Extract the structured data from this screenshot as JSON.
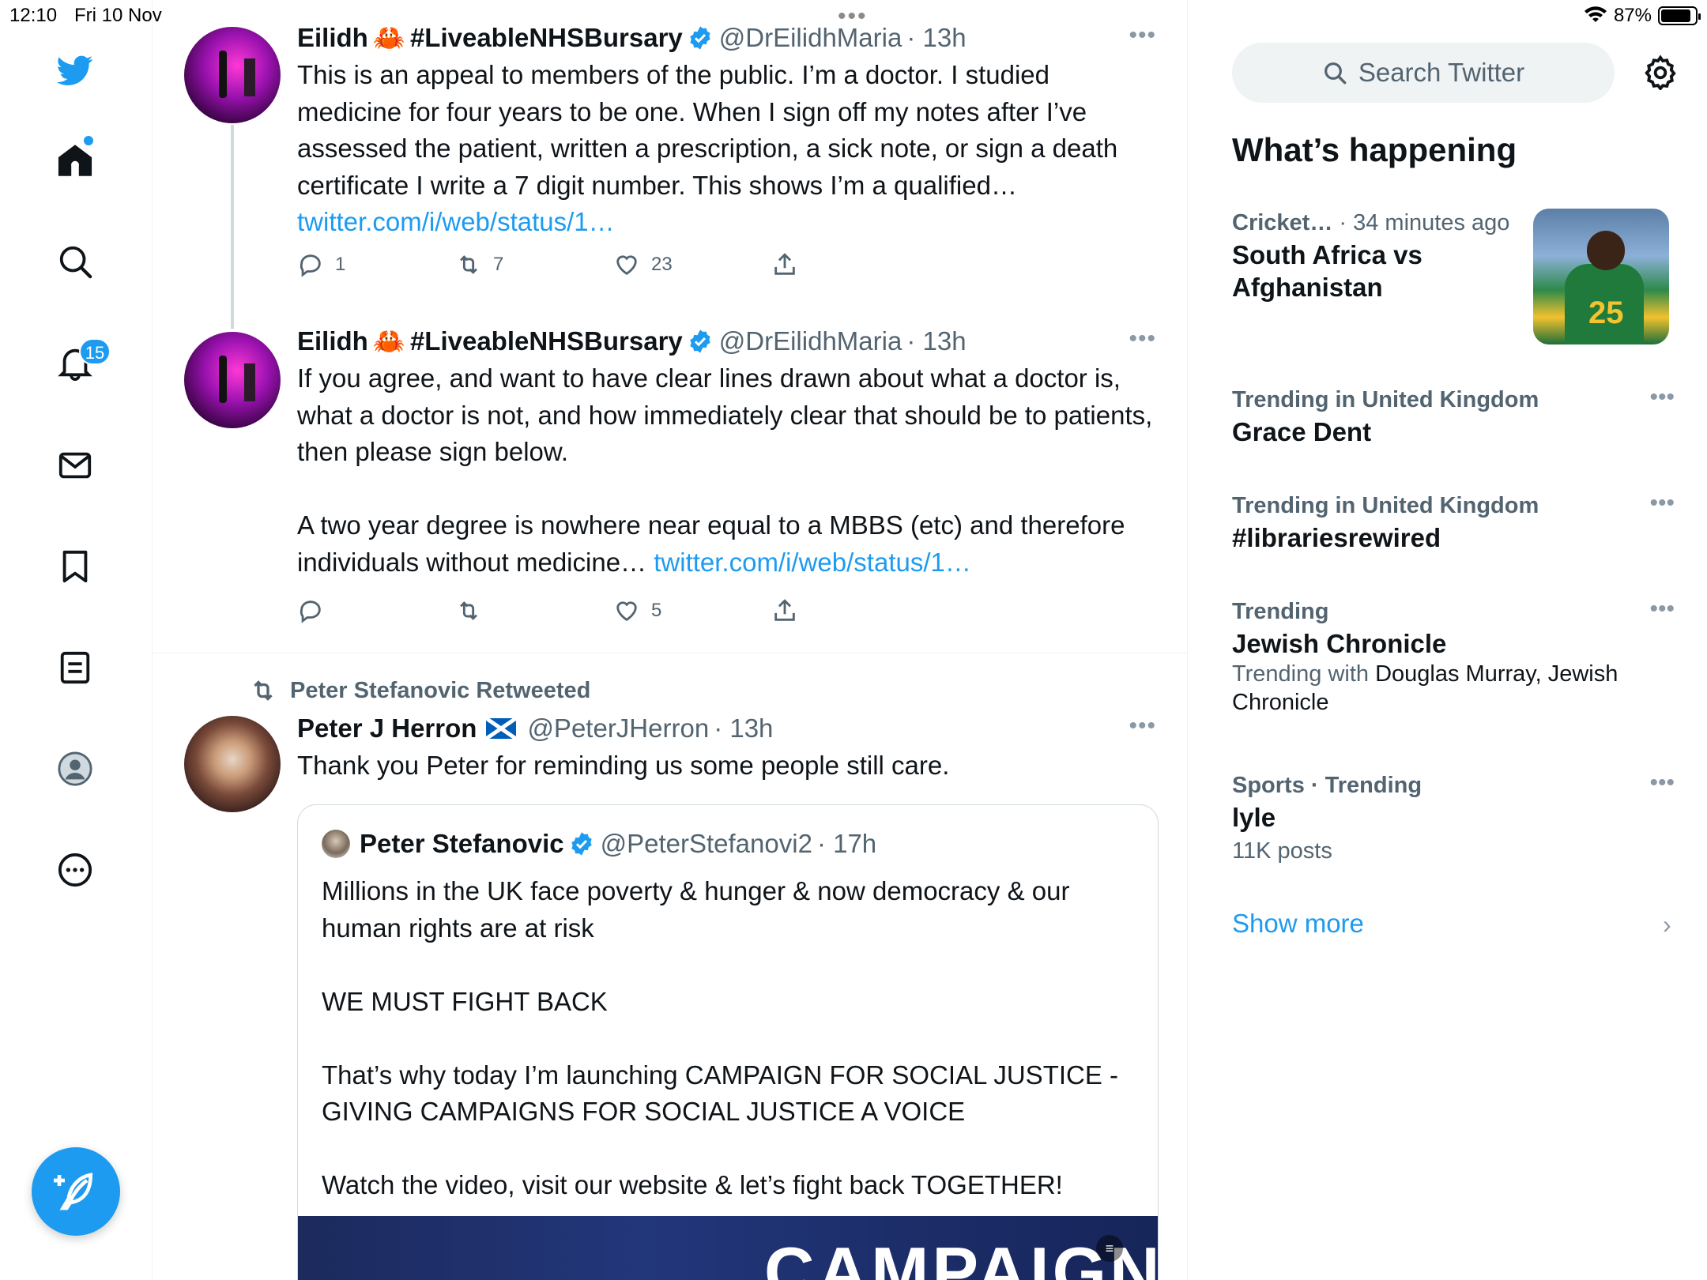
{
  "status_bar": {
    "time": "12:10",
    "date": "Fri 10 Nov",
    "battery": "87%",
    "battery_level": 0.87
  },
  "nav": {
    "notifications_badge": "15",
    "items": [
      "home-icon",
      "search-icon",
      "bell-icon",
      "mail-icon",
      "bookmark-icon",
      "lists-icon",
      "profile-icon",
      "more-icon"
    ]
  },
  "tweets": [
    {
      "name": "Eilidh",
      "emoji": "🦀",
      "hashtag": "#LiveableNHSBursary",
      "handle": "@DrEilidhMaria",
      "time": "· 13h",
      "text": "This is an appeal to members of the public. I’m a doctor. I studied medicine for four years to be one. When I sign off my notes after I’ve assessed the patient, written a prescription, a sick note, or sign a death certificate I write a 7 digit number. This shows I’m a qualified…",
      "link": "twitter.com/i/web/status/1…",
      "replies": "1",
      "retweets": "7",
      "likes": "23"
    },
    {
      "name": "Eilidh",
      "emoji": "🦀",
      "hashtag": "#LiveableNHSBursary",
      "handle": "@DrEilidhMaria",
      "time": "· 13h",
      "text": "If you agree, and want to have clear lines drawn about what a doctor is, what a doctor is not, and how immediately clear that should be to patients, then please sign below.\n\nA two year degree is nowhere near equal to a MBBS (etc) and therefore individuals without medicine… ",
      "link": "twitter.com/i/web/status/1…",
      "replies": "",
      "retweets": "",
      "likes": "5"
    },
    {
      "retweeted_by": "Peter Stefanovic Retweeted",
      "name": "Peter J Herron",
      "handle": "@PeterJHerron",
      "time": "· 13h",
      "text": "Thank you Peter for reminding us some people still care.",
      "quote": {
        "name": "Peter Stefanovic",
        "handle": "@PeterStefanovi2",
        "time": "· 17h",
        "text": "Millions in the UK face poverty & hunger & now democracy & our human rights are at risk\n\nWE MUST FIGHT BACK\n\nThat’s why today I’m launching CAMPAIGN FOR SOCIAL JUSTICE - GIVING CAMPAIGNS FOR SOCIAL JUSTICE A VOICE\n\nWatch the video, visit our website & let’s fight back TOGETHER!",
        "media_text": "CAMPAIGN"
      }
    }
  ],
  "sidebar": {
    "search_placeholder": "Search Twitter",
    "title": "What’s happening",
    "trends": [
      {
        "category": "Cricket…",
        "meta": " · 34 minutes ago",
        "name": "South Africa vs Afghanistan"
      },
      {
        "category": "Trending in United Kingdom",
        "name": "Grace Dent"
      },
      {
        "category": "Trending in United Kingdom",
        "name": "#librariesrewired"
      },
      {
        "category": "Trending",
        "name": "Jewish Chronicle",
        "sub_label": "Trending with ",
        "sub_value": "Douglas Murray, Jewish Chronicle"
      },
      {
        "category": "Sports · Trending",
        "name": "lyle",
        "posts": "11K posts"
      }
    ],
    "show_more": "Show more",
    "cricket_image_number": "25"
  },
  "colors": {
    "accent": "#1d9bf0",
    "text": "#0f1419",
    "secondary": "#536471"
  }
}
